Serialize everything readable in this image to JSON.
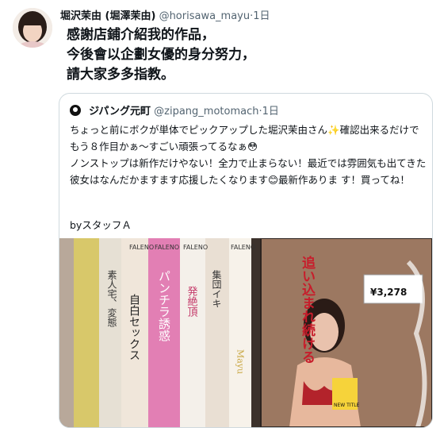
{
  "tweet": {
    "author_name": "堀沢茉由 (堀澤茉由)",
    "author_handle": "@horisawa_mayu",
    "separator": "·",
    "time": "1日",
    "text": "感謝店鋪介紹我的作品，\n今後會以企劃女優的身分努力，\n請大家多多指教。"
  },
  "quote": {
    "author_name": "ジパング元町",
    "author_handle": "@zipang_motomach",
    "separator": "·",
    "time": "1日",
    "text": "ちょっと前にボクが単体でピックアップした堀沢茉由さん✨確認出来るだけでもう８作目かぁ〜すごい頑張ってるなぁ😳\nノンストップは新作だけやない！全力で止まらない！最近では雰囲気も出てきた彼女はなんだかますます応援したくなります😊最新作ありま す！買ってね！",
    "signature": "byスタッフＡ",
    "image": {
      "box_texts": [
        "FALENO",
        "FALENO",
        "FALENO",
        "FALENO"
      ],
      "spine_texts": [
        "素人宅、変態",
        "自白セックス",
        "パンチラ誘惑",
        "発絶頂",
        "集団イキ",
        "Mayu"
      ],
      "poster_text": "追い込まれ続ける",
      "price_tag": "¥3,278",
      "new_title_label": "NEW TITLE"
    }
  }
}
